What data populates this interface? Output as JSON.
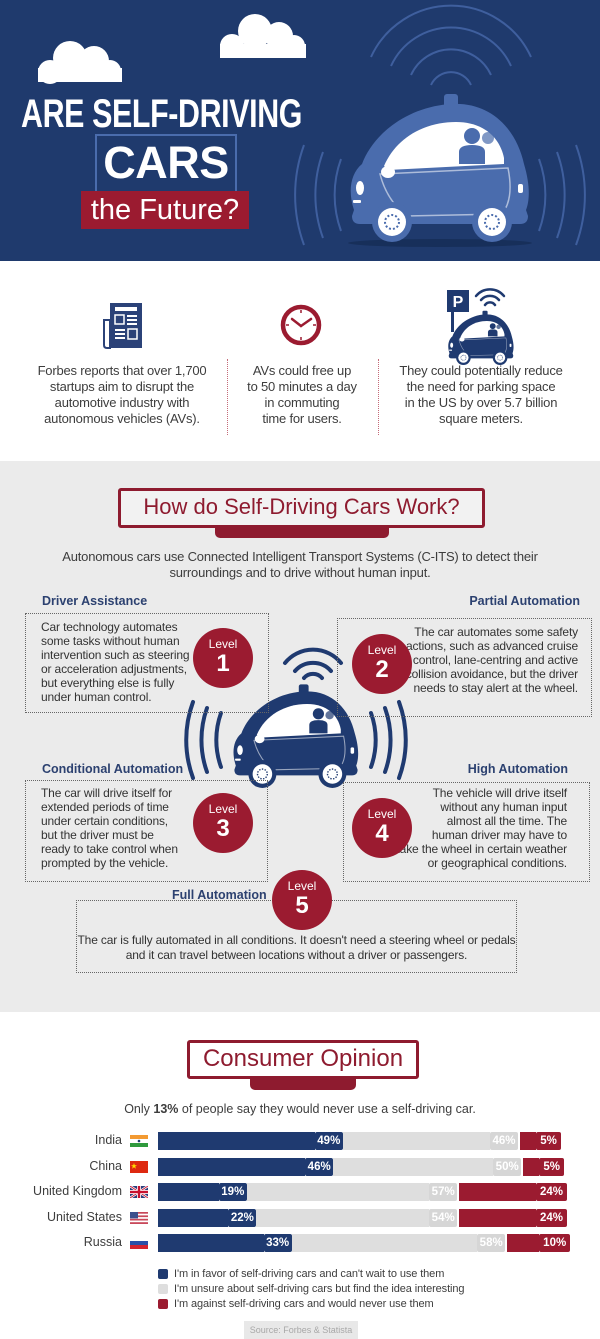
{
  "header": {
    "title_line1": "ARE SELF-DRIVING",
    "title_line2": "CARS",
    "title_line3": "the Future?"
  },
  "stats": [
    {
      "icon": "newspaper-icon",
      "lines": [
        "Forbes reports that over 1,700",
        "startups aim to disrupt the",
        "automotive industry with",
        "autonomous vehicles (AVs)."
      ]
    },
    {
      "icon": "clock-icon",
      "lines": [
        "AVs could free up",
        "to 50 minutes a day",
        "in commuting",
        "time for users."
      ]
    },
    {
      "icon": "parking-car-icon",
      "parking_sign": "P",
      "lines": [
        "They could potentially reduce",
        "the need for parking space",
        "in the US by over 5.7 billion",
        "square meters."
      ]
    }
  ],
  "how_it_works": {
    "title": "How do Self-Driving Cars Work?",
    "intro_lines": [
      "Autonomous cars use Connected Intelligent Transport Systems (C-ITS) to detect their",
      "surroundings and to drive without human input."
    ],
    "levels": [
      {
        "heading": "Driver Assistance",
        "badge_label": "Level",
        "badge_number": "1",
        "lines": [
          "Car technology automates",
          "some tasks without human",
          "intervention such as steering",
          "or acceleration adjustments,",
          "but everything else is fully",
          "under human control."
        ]
      },
      {
        "heading": "Partial Automation",
        "badge_label": "Level",
        "badge_number": "2",
        "lines": [
          "The car automates some safety",
          "actions, such as advanced cruise",
          "control, lane-centring and active",
          "collision avoidance, but the driver",
          "needs to stay alert at the wheel."
        ]
      },
      {
        "heading": "Conditional Automation",
        "badge_label": "Level",
        "badge_number": "3",
        "lines": [
          "The car will drive itself for",
          "extended periods of time",
          "under certain conditions,",
          "but the driver must be",
          "ready to take control when",
          "prompted by the vehicle."
        ]
      },
      {
        "heading": "High Automation",
        "badge_label": "Level",
        "badge_number": "4",
        "lines": [
          "The vehicle will drive itself",
          "without any human input",
          "almost all the time. The",
          "human driver may have to",
          "take the wheel in certain weather",
          "or geographical conditions."
        ]
      },
      {
        "heading": "Full Automation",
        "badge_label": "Level",
        "badge_number": "5",
        "lines": [
          "The car is fully automated in all conditions. It doesn't need a steering wheel or pedals",
          "and it can travel between locations without a driver or passengers."
        ]
      }
    ]
  },
  "consumer_opinion": {
    "title": "Consumer Opinion",
    "subtitle_prefix": "Only ",
    "subtitle_highlight": "13%",
    "subtitle_suffix": " of people say they would never use a self-driving car.",
    "flags": [
      "india-flag-icon",
      "china-flag-icon",
      "uk-flag-icon",
      "us-flag-icon",
      "russia-flag-icon"
    ],
    "source": "Source: Forbes & Statista"
  },
  "colors": {
    "navy": "#1f3a6d",
    "car_light_blue": "#4a6cad",
    "maroon": "#9b1b30",
    "unsure_gray": "#dedede",
    "section_gray": "#ebebeb",
    "heading_navy": "#2c4170"
  },
  "chart_data": {
    "type": "bar",
    "orientation": "horizontal",
    "stacked": true,
    "title": "Consumer Opinion",
    "subtitle": "Only 13% of people say they would never use a self-driving car.",
    "categories": [
      "India",
      "China",
      "United Kingdom",
      "United States",
      "Russia"
    ],
    "series": [
      {
        "name": "I'm in favor of self-driving cars and can't wait to use them",
        "color": "#1f3a70",
        "values": [
          49,
          46,
          19,
          22,
          33
        ]
      },
      {
        "name": "I'm unsure about self-driving cars but find the idea interesting",
        "color": "#dedede",
        "values": [
          46,
          50,
          57,
          54,
          58
        ]
      },
      {
        "name": "I'm against self-driving cars and would never use them",
        "color": "#9b1b30",
        "values": [
          5,
          5,
          24,
          24,
          10
        ]
      }
    ],
    "value_suffix": "%",
    "xlabel": "",
    "ylabel": "",
    "xlim": [
      0,
      100
    ],
    "legend": "bottom",
    "grid": false,
    "source": "Source: Forbes & Statista"
  }
}
